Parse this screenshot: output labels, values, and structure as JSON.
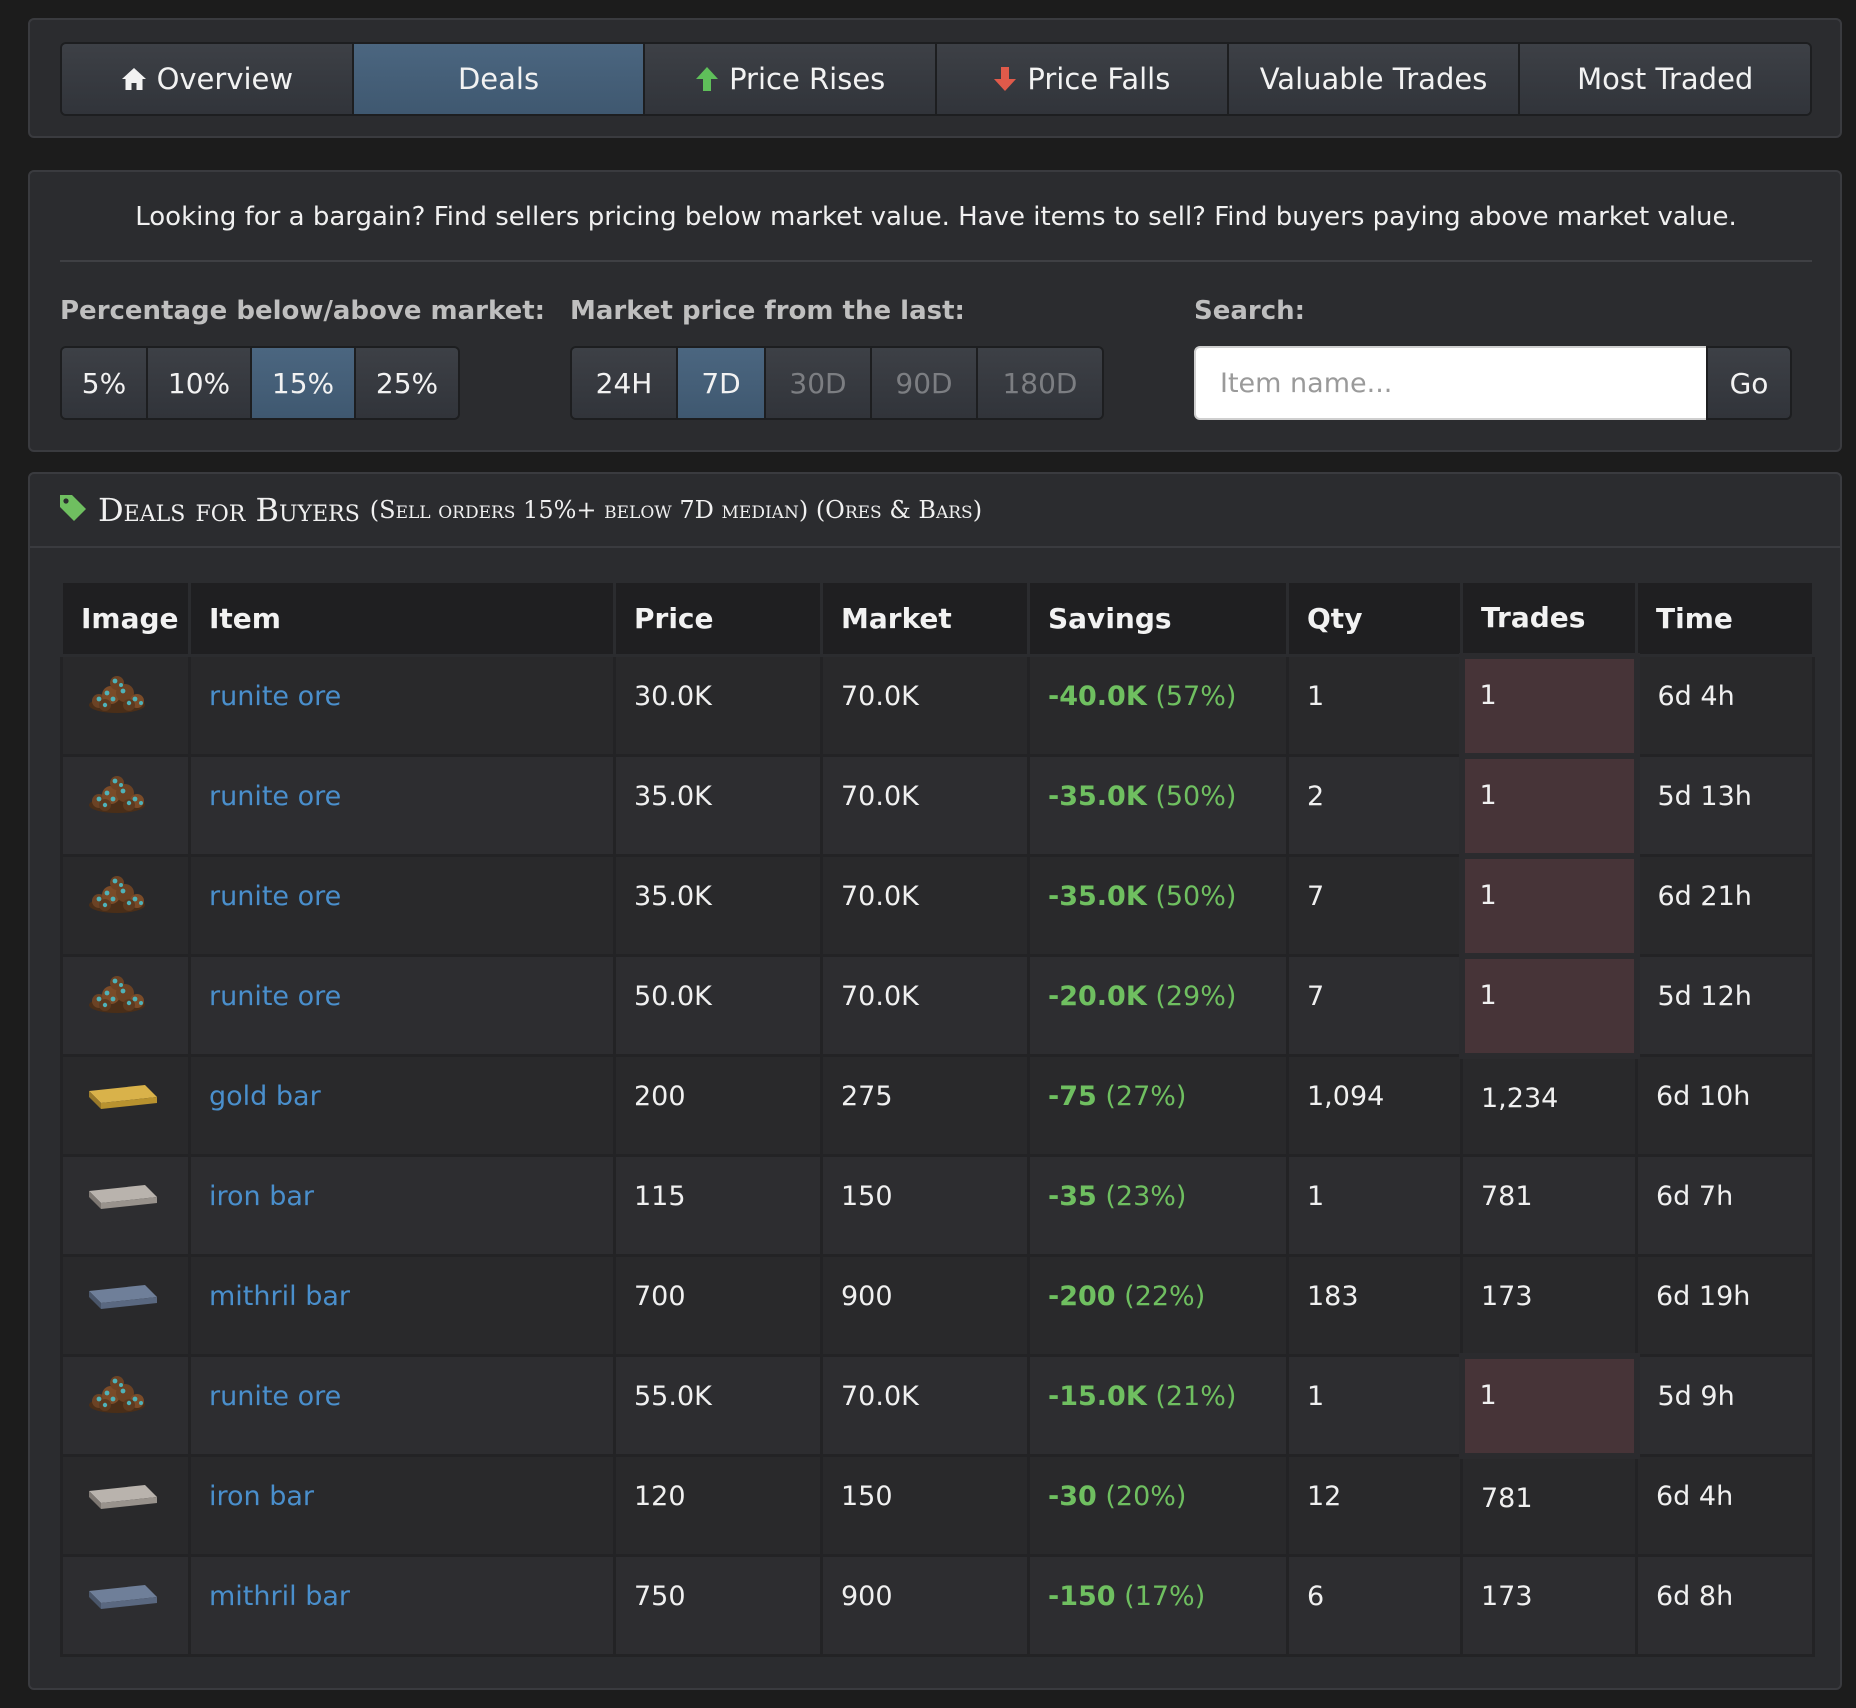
{
  "nav": {
    "tabs": [
      {
        "label": "Overview",
        "icon": "home-icon"
      },
      {
        "label": "Deals",
        "icon": ""
      },
      {
        "label": "Price Rises",
        "icon": "arrow-up-icon"
      },
      {
        "label": "Price Falls",
        "icon": "arrow-down-icon"
      },
      {
        "label": "Valuable Trades",
        "icon": ""
      },
      {
        "label": "Most Traded",
        "icon": ""
      }
    ],
    "active": "Deals"
  },
  "filters": {
    "intro": "Looking for a bargain? Find sellers pricing below market value. Have items to sell? Find buyers paying above market value.",
    "percentage": {
      "label": "Percentage below/above market:",
      "options": [
        "5%",
        "10%",
        "15%",
        "25%"
      ],
      "selected": "15%"
    },
    "period": {
      "label": "Market price from the last:",
      "options": [
        "24H",
        "7D",
        "30D",
        "90D",
        "180D"
      ],
      "selected": "7D"
    },
    "search": {
      "label": "Search:",
      "placeholder": "Item name...",
      "value": "",
      "button": "Go"
    }
  },
  "deals": {
    "title": "Deals for Buyers",
    "subtitle": "(Sell orders 15%+ below 7D median) (Ores & Bars)",
    "icon": "tag-icon",
    "columns": [
      "Image",
      "Item",
      "Price",
      "Market",
      "Savings",
      "Qty",
      "Trades",
      "Time"
    ],
    "rows": [
      {
        "image": "runite-ore-icon",
        "item": "runite ore",
        "price": "30.0K",
        "market": "70.0K",
        "savings": "-40.0K",
        "savings_pct": "(57%)",
        "qty": "1",
        "trades": "1",
        "time": "6d 4h",
        "highlight": true
      },
      {
        "image": "runite-ore-icon",
        "item": "runite ore",
        "price": "35.0K",
        "market": "70.0K",
        "savings": "-35.0K",
        "savings_pct": "(50%)",
        "qty": "2",
        "trades": "1",
        "time": "5d 13h",
        "highlight": true
      },
      {
        "image": "runite-ore-icon",
        "item": "runite ore",
        "price": "35.0K",
        "market": "70.0K",
        "savings": "-35.0K",
        "savings_pct": "(50%)",
        "qty": "7",
        "trades": "1",
        "time": "6d 21h",
        "highlight": true
      },
      {
        "image": "runite-ore-icon",
        "item": "runite ore",
        "price": "50.0K",
        "market": "70.0K",
        "savings": "-20.0K",
        "savings_pct": "(29%)",
        "qty": "7",
        "trades": "1",
        "time": "5d 12h",
        "highlight": true
      },
      {
        "image": "gold-bar-icon",
        "item": "gold bar",
        "price": "200",
        "market": "275",
        "savings": "-75",
        "savings_pct": "(27%)",
        "qty": "1,094",
        "trades": "1,234",
        "time": "6d 10h",
        "highlight": false
      },
      {
        "image": "iron-bar-icon",
        "item": "iron bar",
        "price": "115",
        "market": "150",
        "savings": "-35",
        "savings_pct": "(23%)",
        "qty": "1",
        "trades": "781",
        "time": "6d 7h",
        "highlight": false
      },
      {
        "image": "mithril-bar-icon",
        "item": "mithril bar",
        "price": "700",
        "market": "900",
        "savings": "-200",
        "savings_pct": "(22%)",
        "qty": "183",
        "trades": "173",
        "time": "6d 19h",
        "highlight": false
      },
      {
        "image": "runite-ore-icon",
        "item": "runite ore",
        "price": "55.0K",
        "market": "70.0K",
        "savings": "-15.0K",
        "savings_pct": "(21%)",
        "qty": "1",
        "trades": "1",
        "time": "5d 9h",
        "highlight": true
      },
      {
        "image": "iron-bar-icon",
        "item": "iron bar",
        "price": "120",
        "market": "150",
        "savings": "-30",
        "savings_pct": "(20%)",
        "qty": "12",
        "trades": "781",
        "time": "6d 4h",
        "highlight": false
      },
      {
        "image": "mithril-bar-icon",
        "item": "mithril bar",
        "price": "750",
        "market": "900",
        "savings": "-150",
        "savings_pct": "(17%)",
        "qty": "6",
        "trades": "173",
        "time": "6d 8h",
        "highlight": false
      }
    ]
  },
  "colors": {
    "background": "#1c1c1c",
    "panel": "#2b2c2f",
    "active_button": "#4b6680",
    "link": "#4a8fcc",
    "savings": "#6fbf60",
    "trades_highlight": "#473438",
    "arrow_up": "#5fbf5a",
    "arrow_down": "#e05a4a",
    "tag": "#6fbf60"
  }
}
